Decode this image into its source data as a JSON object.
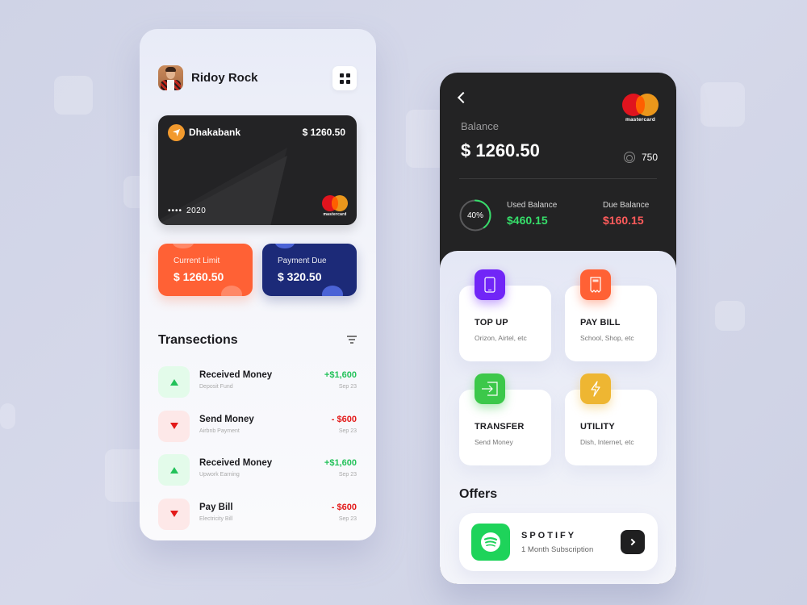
{
  "left_screen": {
    "profile": {
      "name": "Ridoy Rock"
    },
    "card": {
      "bank_name": "Dhakabank",
      "balance": "$ 1260.50",
      "masked_number": "••••",
      "year": "2020",
      "brand": "mastercard"
    },
    "mini_cards": [
      {
        "label": "Current Limit",
        "value": "$ 1260.50",
        "color": "#ff6135"
      },
      {
        "label": "Payment Due",
        "value": "$ 320.50",
        "color": "#1c2a78"
      }
    ],
    "transactions_title": "Transections",
    "transactions": [
      {
        "direction": "up",
        "title": "Received Money",
        "subtitle": "Deposit Fund",
        "amount": "+$1,600",
        "date": "Sep 23"
      },
      {
        "direction": "down",
        "title": "Send Money",
        "subtitle": "Airbnb Payment",
        "amount": "- $600",
        "date": "Sep 23"
      },
      {
        "direction": "up",
        "title": "Received Money",
        "subtitle": "Upwork Earning",
        "amount": "+$1,600",
        "date": "Sep 23"
      },
      {
        "direction": "down",
        "title": "Pay Bill",
        "subtitle": "Electricity Bill",
        "amount": "- $600",
        "date": "Sep 23"
      }
    ]
  },
  "right_screen": {
    "brand": "mastercard",
    "balance_label": "Balance",
    "balance_value": "$ 1260.50",
    "points": "750",
    "used_percent": 40,
    "used_percent_label": "40%",
    "used_balance_label": "Used Balance",
    "used_balance_value": "$460.15",
    "due_balance_label": "Due Balance",
    "due_balance_value": "$160.15",
    "services": [
      {
        "title": "TOP UP",
        "subtitle": "Orizon, Airtel, etc",
        "icon": "phone-icon",
        "color": "#7125f7"
      },
      {
        "title": "PAY BILL",
        "subtitle": "School, Shop, etc",
        "icon": "receipt-icon",
        "color": "#ff6135"
      },
      {
        "title": "TRANSFER",
        "subtitle": "Send Money",
        "icon": "transfer-icon",
        "color": "#3cc84a"
      },
      {
        "title": "UTILITY",
        "subtitle": "Dish, Internet, etc",
        "icon": "lightning-icon",
        "color": "#eeb632"
      }
    ],
    "offers_title": "Offers",
    "offer": {
      "title": "SPOTIFY",
      "subtitle": "1 Month Subscription"
    }
  },
  "colors": {
    "positive": "#23c25a",
    "negative": "#e31a1a",
    "used_green": "#36de6a",
    "due_red": "#ff5b5b"
  }
}
